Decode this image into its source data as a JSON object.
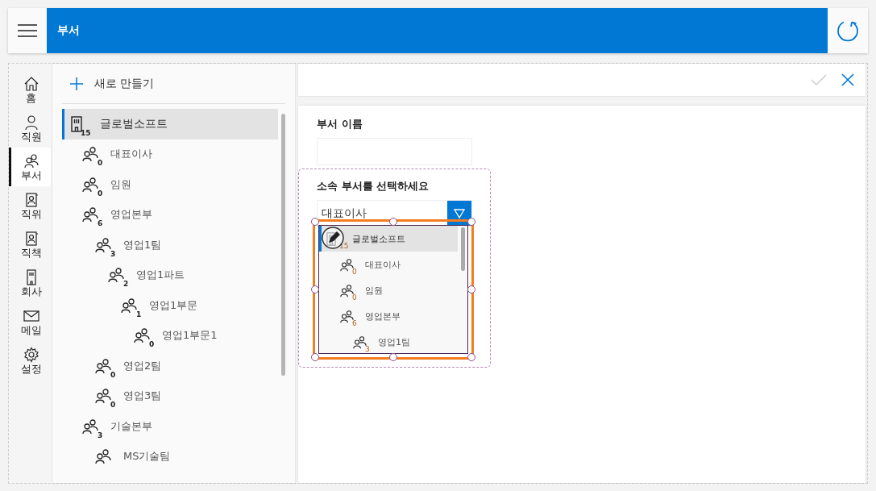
{
  "app_bar": {
    "title": "부서"
  },
  "nav": [
    {
      "label": "홈",
      "selected": false
    },
    {
      "label": "직원",
      "selected": false
    },
    {
      "label": "부서",
      "selected": true
    },
    {
      "label": "직위",
      "selected": false
    },
    {
      "label": "직책",
      "selected": false
    },
    {
      "label": "회사",
      "selected": false
    },
    {
      "label": "메일",
      "selected": false
    },
    {
      "label": "설정",
      "selected": false
    }
  ],
  "new_button": {
    "label": "새로 만들기"
  },
  "tree": [
    {
      "kind": "company",
      "label": "글로벌소프트",
      "count": "15",
      "selected": true,
      "children": [
        {
          "kind": "department",
          "label": "대표이사",
          "count": "0",
          "selected": false
        },
        {
          "kind": "department",
          "label": "임원",
          "count": "0",
          "selected": false
        },
        {
          "kind": "department",
          "label": "영업본부",
          "count": "6",
          "selected": false,
          "children": [
            {
              "kind": "department",
              "label": "영업1팀",
              "count": "3",
              "selected": false,
              "children": [
                {
                  "kind": "department",
                  "label": "영업1파트",
                  "count": "2",
                  "selected": false,
                  "children": [
                    {
                      "kind": "department",
                      "label": "영업1부문",
                      "count": "1",
                      "selected": false,
                      "children": [
                        {
                          "kind": "department",
                          "label": "영업1부문1",
                          "count": "0",
                          "selected": false
                        }
                      ]
                    }
                  ]
                }
              ]
            },
            {
              "kind": "department",
              "label": "영업2팀",
              "count": "0",
              "selected": false
            },
            {
              "kind": "department",
              "label": "영업3팀",
              "count": "0",
              "selected": false
            }
          ]
        },
        {
          "kind": "department",
          "label": "기술본부",
          "count": "3",
          "selected": false,
          "children": [
            {
              "kind": "department",
              "label": "MS기술팀",
              "selected": false
            }
          ]
        }
      ]
    }
  ],
  "toolbar": {
    "save_disabled": true
  },
  "form": {
    "name_label": "부서 이름",
    "parent_label": "소속 부서를 선택하세요",
    "parent_value": "대표이사",
    "dropdown": [
      {
        "kind": "company",
        "label": "글로벌소프트",
        "count": "15",
        "selected": true,
        "children": [
          {
            "kind": "department",
            "label": "대표이사",
            "count": "0",
            "selected": false
          },
          {
            "kind": "department",
            "label": "임원",
            "count": "0",
            "selected": false
          },
          {
            "kind": "department",
            "label": "영업본부",
            "count": "6",
            "selected": false,
            "children": [
              {
                "kind": "department",
                "label": "영업1팀",
                "count": "3",
                "selected": false
              }
            ]
          }
        ]
      }
    ]
  }
}
